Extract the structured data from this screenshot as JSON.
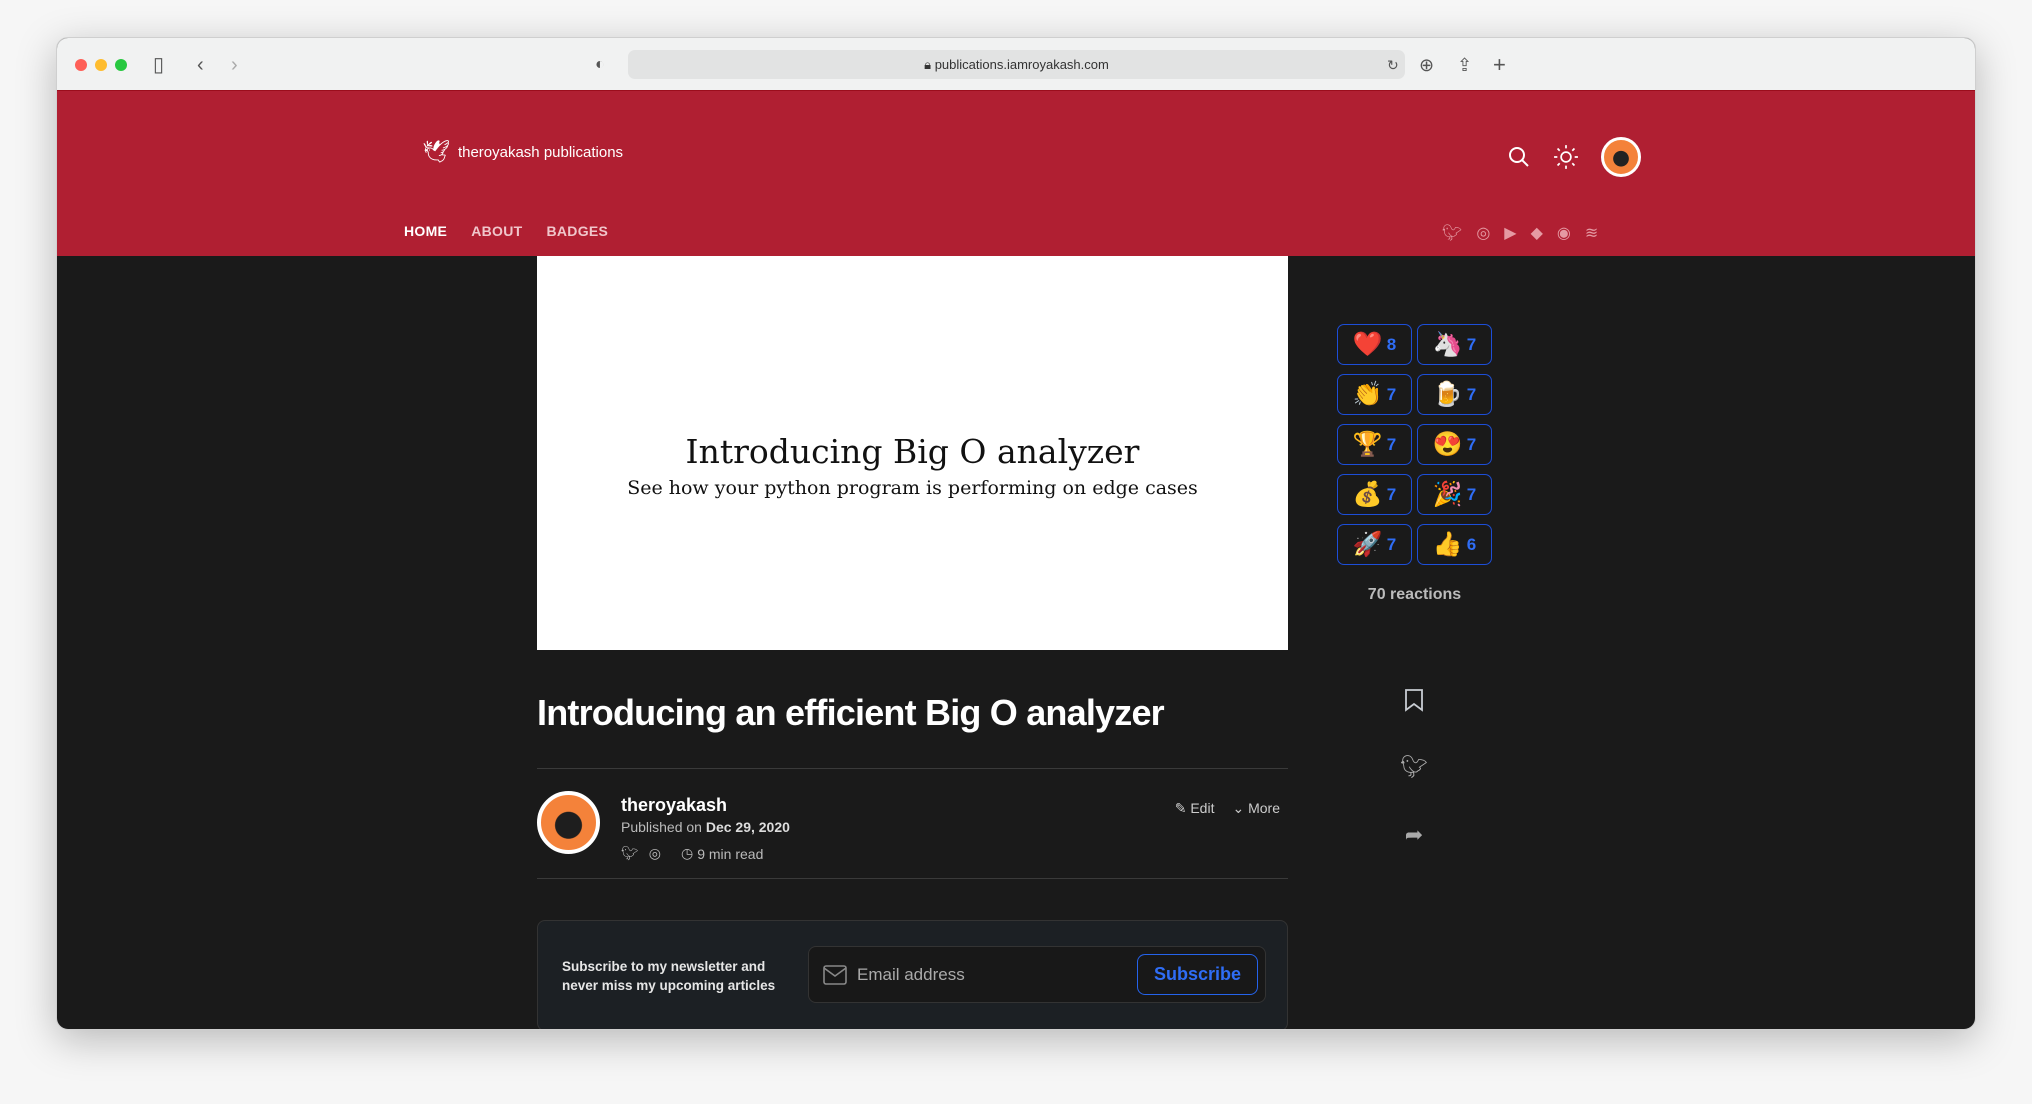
{
  "browser": {
    "url": "publications.iamroyakash.com"
  },
  "header": {
    "logo_text": "theroyakash publications",
    "nav": [
      {
        "label": "HOME",
        "active": true
      },
      {
        "label": "ABOUT"
      },
      {
        "label": "BADGES"
      }
    ],
    "social_icons": [
      "twitter-icon",
      "github-icon",
      "youtube-icon",
      "hashnode-icon",
      "globe-icon",
      "rss-icon"
    ]
  },
  "cover": {
    "title": "Introducing Big O analyzer",
    "subtitle": "See how your python program is performing on edge cases"
  },
  "article": {
    "title": "Introducing an efficient Big O analyzer",
    "author": {
      "name": "theroyakash",
      "published_prefix": "Published on",
      "date": "Dec 29, 2020",
      "read_time": "9 min read"
    },
    "actions": {
      "edit": "Edit",
      "more": "More"
    }
  },
  "newsletter": {
    "text_line1": "Subscribe to my newsletter and",
    "text_line2": "never miss my upcoming articles",
    "email_placeholder": "Email address",
    "button": "Subscribe"
  },
  "reactions": {
    "items": [
      {
        "emoji": "❤️",
        "count": "8"
      },
      {
        "emoji": "🦄",
        "count": "7"
      },
      {
        "emoji": "👏",
        "count": "7"
      },
      {
        "emoji": "🍺",
        "count": "7"
      },
      {
        "emoji": "🏆",
        "count": "7"
      },
      {
        "emoji": "😍",
        "count": "7"
      },
      {
        "emoji": "💰",
        "count": "7"
      },
      {
        "emoji": "🎉",
        "count": "7"
      },
      {
        "emoji": "🚀",
        "count": "7"
      },
      {
        "emoji": "👍",
        "count": "6"
      }
    ],
    "total": "70 reactions"
  },
  "colors": {
    "header": "#b01f32",
    "accent": "#2563eb",
    "background": "#1a1a1a"
  }
}
